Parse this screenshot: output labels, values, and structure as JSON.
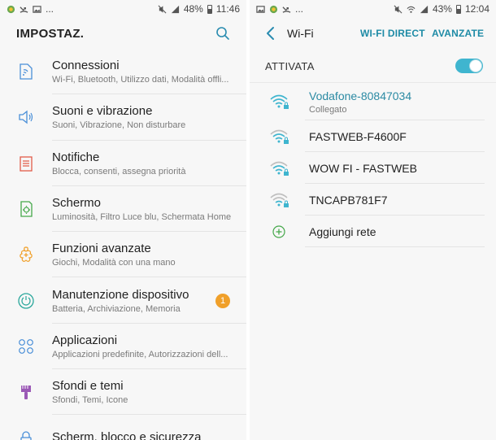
{
  "left": {
    "status": {
      "battery": "48%",
      "time": "11:46",
      "more": "..."
    },
    "header": {
      "title": "IMPOSTAZ."
    },
    "items": [
      {
        "title": "Connessioni",
        "subtitle": "Wi-Fi, Bluetooth, Utilizzo dati, Modalità offli...",
        "icon": "connections-icon",
        "color": "#4a8fd8"
      },
      {
        "title": "Suoni e vibrazione",
        "subtitle": "Suoni, Vibrazione, Non disturbare",
        "icon": "speaker-icon",
        "color": "#4a8fd8"
      },
      {
        "title": "Notifiche",
        "subtitle": "Blocca, consenti, assegna priorità",
        "icon": "notifications-icon",
        "color": "#e25b4a"
      },
      {
        "title": "Schermo",
        "subtitle": "Luminosità, Filtro Luce blu, Schermata Home",
        "icon": "display-icon",
        "color": "#45a84a"
      },
      {
        "title": "Funzioni avanzate",
        "subtitle": "Giochi, Modalità con una mano",
        "icon": "advanced-features-icon",
        "color": "#f0a02a"
      },
      {
        "title": "Manutenzione dispositivo",
        "subtitle": "Batteria, Archiviazione, Memoria",
        "icon": "device-maintenance-icon",
        "color": "#2aa79b",
        "badge": "1"
      },
      {
        "title": "Applicazioni",
        "subtitle": "Applicazioni predefinite, Autorizzazioni dell...",
        "icon": "apps-icon",
        "color": "#4a8fd8"
      },
      {
        "title": "Sfondi e temi",
        "subtitle": "Sfondi, Temi, Icone",
        "icon": "brush-icon",
        "color": "#9b59b6"
      },
      {
        "title": "Scherm. blocco e sicurezza",
        "subtitle": "",
        "icon": "lock-icon",
        "color": "#4a8fd8"
      }
    ]
  },
  "right": {
    "status": {
      "battery": "43%",
      "time": "12:04"
    },
    "header": {
      "title": "Wi-Fi",
      "wifi_direct": "WI-FI DIRECT",
      "advanced": "AVANZATE"
    },
    "toggle": {
      "label": "ATTIVATA",
      "on": true,
      "accent": "#3fb5cf"
    },
    "networks": [
      {
        "name": "Vodafone-80847034",
        "status": "Collegato",
        "connected": true
      },
      {
        "name": "FASTWEB-F4600F",
        "connected": false
      },
      {
        "name": "WOW FI - FASTWEB",
        "connected": false
      },
      {
        "name": "TNCAPB781F7",
        "connected": false
      }
    ],
    "add_network": "Aggiungi rete"
  }
}
